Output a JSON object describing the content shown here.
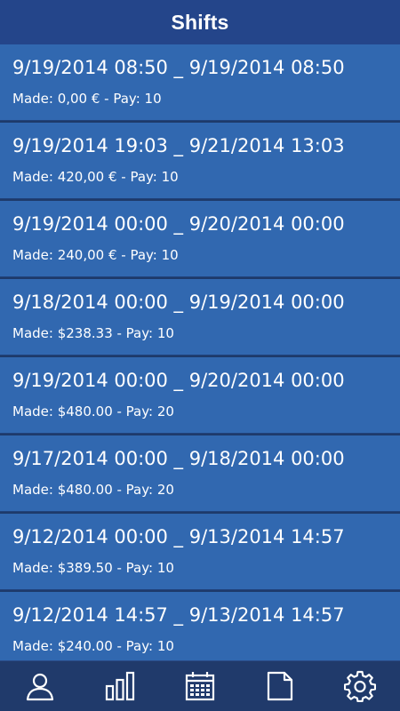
{
  "header": {
    "title": "Shifts"
  },
  "shifts": [
    {
      "range": "9/19/2014 08:50 _ 9/19/2014 08:50",
      "made": "Made: 0,00 € - Pay: 10"
    },
    {
      "range": "9/19/2014 19:03 _ 9/21/2014 13:03",
      "made": "Made: 420,00 € - Pay: 10"
    },
    {
      "range": "9/19/2014 00:00 _ 9/20/2014 00:00",
      "made": "Made: 240,00 € - Pay: 10"
    },
    {
      "range": "9/18/2014 00:00 _ 9/19/2014 00:00",
      "made": "Made: $238.33 - Pay: 10"
    },
    {
      "range": "9/19/2014 00:00 _ 9/20/2014 00:00",
      "made": "Made: $480.00 - Pay: 20"
    },
    {
      "range": "9/17/2014 00:00 _ 9/18/2014 00:00",
      "made": "Made: $480.00 - Pay: 20"
    },
    {
      "range": "9/12/2014 00:00 _ 9/13/2014 14:57",
      "made": "Made: $389.50 - Pay: 10"
    },
    {
      "range": "9/12/2014 14:57 _ 9/13/2014 14:57",
      "made": "Made: $240.00 - Pay: 10"
    }
  ],
  "tabbar": {
    "items": [
      {
        "icon": "user-icon"
      },
      {
        "icon": "bar-chart-icon"
      },
      {
        "icon": "calendar-icon"
      },
      {
        "icon": "document-icon"
      },
      {
        "icon": "gear-icon"
      }
    ]
  },
  "colors": {
    "header_bg": "#24458a",
    "row_bg": "#3168b0",
    "divider": "#20427a",
    "tabbar_bg": "#203a6b",
    "text": "#ffffff"
  }
}
